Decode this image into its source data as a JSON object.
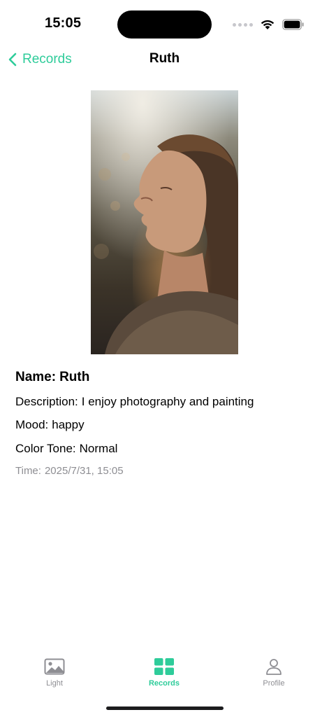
{
  "status": {
    "time": "15:05"
  },
  "nav": {
    "back_label": "Records",
    "title": "Ruth"
  },
  "record": {
    "name_label": "Name:",
    "name": "Ruth",
    "description_label": "Description:",
    "description": "I enjoy photography and painting",
    "mood_label": "Mood:",
    "mood": "happy",
    "tone_label": "Color Tone:",
    "tone": "Normal",
    "time_label": "Time:",
    "time": "2025/7/31, 15:05"
  },
  "tabbar": {
    "tabs": [
      {
        "label": "Light",
        "icon": "photo-icon",
        "active": false
      },
      {
        "label": "Records",
        "icon": "grid-icon",
        "active": true
      },
      {
        "label": "Profile",
        "icon": "person-icon",
        "active": false
      }
    ]
  },
  "colors": {
    "accent": "#2ecc9a",
    "inactive": "#8e8e93"
  }
}
